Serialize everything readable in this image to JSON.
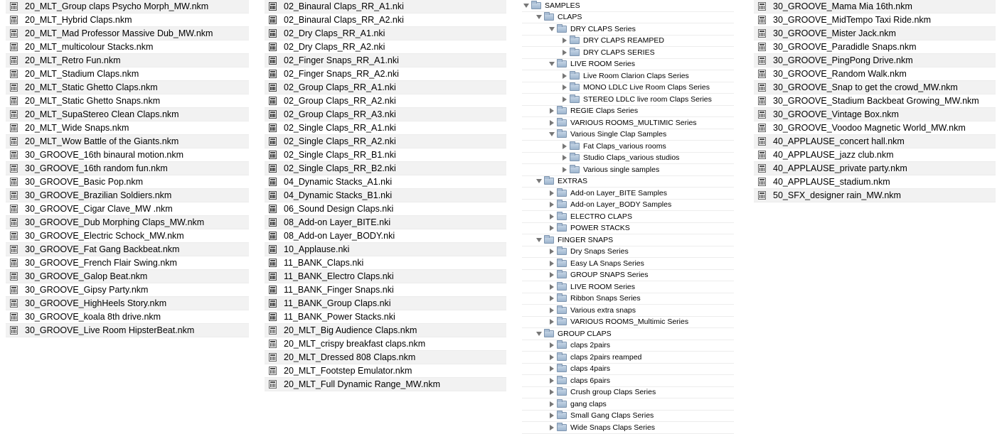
{
  "col1": [
    "20_MLT_Group claps Psycho Morph_MW.nkm",
    "20_MLT_Hybrid Claps.nkm",
    "20_MLT_Mad Professor Massive Dub_MW.nkm",
    "20_MLT_multicolour Stacks.nkm",
    "20_MLT_Retro Fun.nkm",
    "20_MLT_Stadium Claps.nkm",
    "20_MLT_Static Ghetto Claps.nkm",
    "20_MLT_Static Ghetto Snaps.nkm",
    "20_MLT_SupaStereo Clean Claps.nkm",
    "20_MLT_Wide Snaps.nkm",
    "20_MLT_Wow Battle of the Giants.nkm",
    "30_GROOVE_16th binaural motion.nkm",
    "30_GROOVE_16th random fun.nkm",
    "30_GROOVE_Basic Pop.nkm",
    "30_GROOVE_Brazilian Soldiers.nkm",
    "30_GROOVE_Cigar Clave_MW .nkm",
    "30_GROOVE_Dub Morphing Claps_MW.nkm",
    "30_GROOVE_Electric Schock_MW.nkm",
    "30_GROOVE_Fat Gang Backbeat.nkm",
    "30_GROOVE_French Flair Swing.nkm",
    "30_GROOVE_Galop Beat.nkm",
    "30_GROOVE_Gipsy Party.nkm",
    "30_GROOVE_HighHeels Story.nkm",
    "30_GROOVE_koala 8th drive.nkm",
    "30_GROOVE_Live Room HipsterBeat.nkm"
  ],
  "col2": [
    "02_Binaural Claps_RR_A1.nki",
    "02_Binaural Claps_RR_A2.nki",
    "02_Dry Claps_RR_A1.nki",
    "02_Dry Claps_RR_A2.nki",
    "02_Finger Snaps_RR_A1.nki",
    "02_Finger Snaps_RR_A2.nki",
    "02_Group Claps_RR_A1.nki",
    "02_Group Claps_RR_A2.nki",
    "02_Group Claps_RR_A3.nki",
    "02_Single Claps_RR_A1.nki",
    "02_Single Claps_RR_A2.nki",
    "02_Single Claps_RR_B1.nki",
    "02_Single Claps_RR_B2.nki",
    "04_Dynamic Stacks_A1.nki",
    "04_Dynamic Stacks_B1.nki",
    "06_Sound Design Claps.nki",
    "08_Add-on Layer_BITE.nki",
    "08_Add-on Layer_BODY.nki",
    "10_Applause.nki",
    "11_BANK_Claps.nki",
    "11_BANK_Electro Claps.nki",
    "11_BANK_Finger Snaps.nki",
    "11_BANK_Group Claps.nki",
    "11_BANK_Power Stacks.nki",
    "20_MLT_Big Audience Claps.nkm",
    "20_MLT_crispy breakfast claps.nkm",
    "20_MLT_Dressed 808 Claps.nkm",
    "20_MLT_Footstep Emulator.nkm",
    "20_MLT_Full Dynamic Range_MW.nkm"
  ],
  "tree": [
    {
      "label": "SAMPLES",
      "depth": 0,
      "open": true
    },
    {
      "label": "CLAPS",
      "depth": 1,
      "open": true
    },
    {
      "label": "DRY CLAPS Series",
      "depth": 2,
      "open": true
    },
    {
      "label": "DRY CLAPS REAMPED",
      "depth": 3,
      "open": false
    },
    {
      "label": "DRY CLAPS SERIES",
      "depth": 3,
      "open": false
    },
    {
      "label": "LIVE ROOM Series",
      "depth": 2,
      "open": true
    },
    {
      "label": "Live Room Clarion Claps Series",
      "depth": 3,
      "open": false
    },
    {
      "label": "MONO LDLC Live Room Claps Series",
      "depth": 3,
      "open": false
    },
    {
      "label": "STEREO LDLC live room Claps Series",
      "depth": 3,
      "open": false
    },
    {
      "label": "REGIE Claps Series",
      "depth": 2,
      "open": false
    },
    {
      "label": "VARIOUS ROOMS_MULTIMIC Series",
      "depth": 2,
      "open": false
    },
    {
      "label": "Various Single Clap Samples",
      "depth": 2,
      "open": true
    },
    {
      "label": "Fat Claps_various rooms",
      "depth": 3,
      "open": false
    },
    {
      "label": "Studio Claps_various studios",
      "depth": 3,
      "open": false
    },
    {
      "label": "Various single samples",
      "depth": 3,
      "open": false
    },
    {
      "label": "EXTRAS",
      "depth": 1,
      "open": true
    },
    {
      "label": "Add-on Layer_BITE Samples",
      "depth": 2,
      "open": false
    },
    {
      "label": "Add-on Layer_BODY Samples",
      "depth": 2,
      "open": false
    },
    {
      "label": "ELECTRO CLAPS",
      "depth": 2,
      "open": false
    },
    {
      "label": "POWER STACKS",
      "depth": 2,
      "open": false
    },
    {
      "label": "FINGER SNAPS",
      "depth": 1,
      "open": true
    },
    {
      "label": "Dry Snaps Series",
      "depth": 2,
      "open": false
    },
    {
      "label": "Easy LA Snaps Series",
      "depth": 2,
      "open": false
    },
    {
      "label": "GROUP SNAPS Series",
      "depth": 2,
      "open": false
    },
    {
      "label": "LIVE ROOM Series",
      "depth": 2,
      "open": false
    },
    {
      "label": "Ribbon Snaps Series",
      "depth": 2,
      "open": false
    },
    {
      "label": "Various extra snaps",
      "depth": 2,
      "open": false
    },
    {
      "label": "VARIOUS ROOMS_Multimic Series",
      "depth": 2,
      "open": false
    },
    {
      "label": "GROUP CLAPS",
      "depth": 1,
      "open": true
    },
    {
      "label": "claps 2pairs",
      "depth": 2,
      "open": false
    },
    {
      "label": "claps 2pairs reamped",
      "depth": 2,
      "open": false
    },
    {
      "label": "claps 4pairs",
      "depth": 2,
      "open": false
    },
    {
      "label": "claps 6pairs",
      "depth": 2,
      "open": false
    },
    {
      "label": "Crush group Claps Series",
      "depth": 2,
      "open": false
    },
    {
      "label": "gang claps",
      "depth": 2,
      "open": false
    },
    {
      "label": "Small Gang Claps Series",
      "depth": 2,
      "open": false
    },
    {
      "label": "Wide Snaps Claps Series",
      "depth": 2,
      "open": false
    }
  ],
  "col4": [
    "30_GROOVE_Mama Mia 16th.nkm",
    "30_GROOVE_MidTempo Taxi Ride.nkm",
    "30_GROOVE_Mister Jack.nkm",
    "30_GROOVE_Paradidle Snaps.nkm",
    "30_GROOVE_PingPong Drive.nkm",
    "30_GROOVE_Random Walk.nkm",
    "30_GROOVE_Snap to get the crowd_MW.nkm",
    "30_GROOVE_Stadium Backbeat Growing_MW.nkm",
    "30_GROOVE_Vintage Box.nkm",
    "30_GROOVE_Voodoo Magnetic World_MW.nkm",
    "40_APPLAUSE_concert hall.nkm",
    "40_APPLAUSE_jazz club.nkm",
    "40_APPLAUSE_private party.nkm",
    "40_APPLAUSE_stadium.nkm",
    "50_SFX_designer rain_MW.nkm"
  ]
}
